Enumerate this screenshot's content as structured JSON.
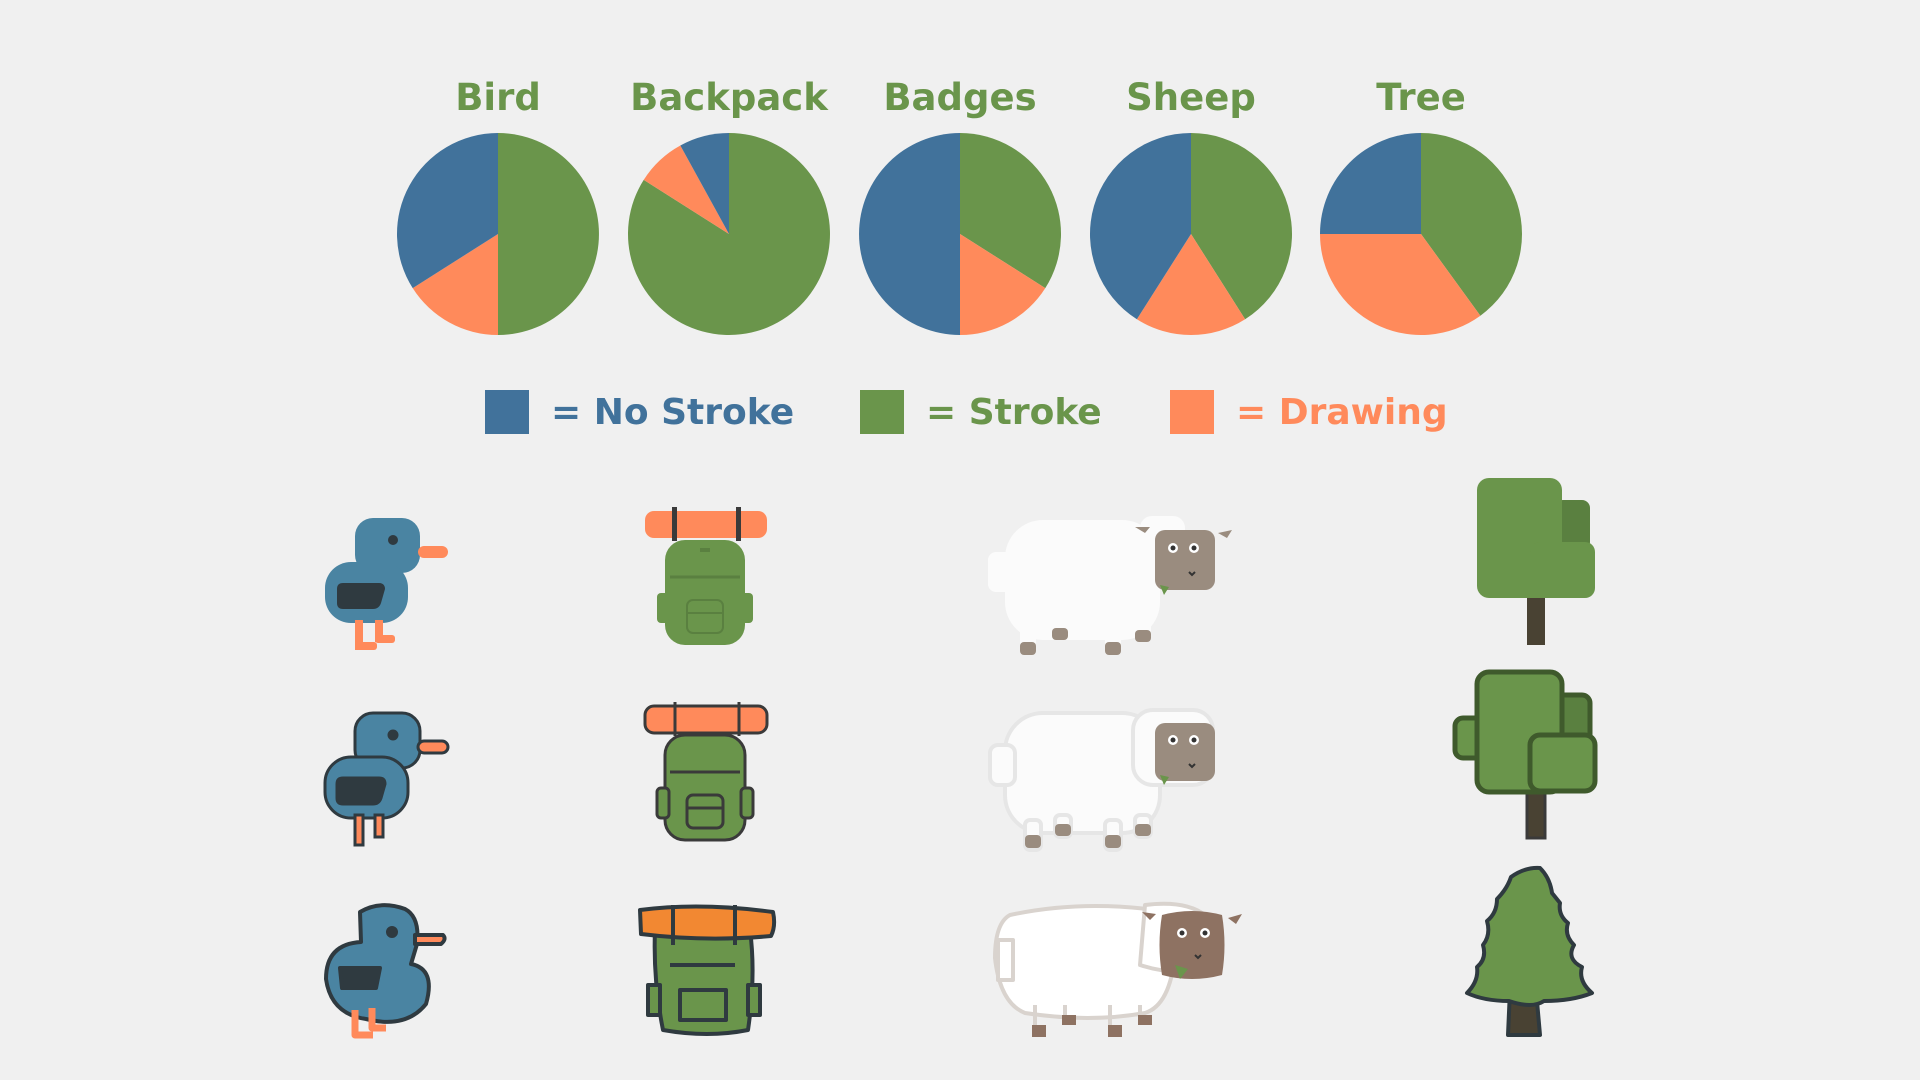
{
  "colors": {
    "no_stroke": "#41729b",
    "stroke": "#6a954b",
    "drawing": "#ff8a5b",
    "background": "#f0f0f0"
  },
  "chart_data": {
    "type": "pie",
    "charts": [
      {
        "title": "Bird",
        "slices": [
          {
            "label": "Stroke",
            "value": 50
          },
          {
            "label": "Drawing",
            "value": 16
          },
          {
            "label": "No Stroke",
            "value": 34
          }
        ]
      },
      {
        "title": "Backpack",
        "slices": [
          {
            "label": "Stroke",
            "value": 84
          },
          {
            "label": "Drawing",
            "value": 8
          },
          {
            "label": "No Stroke",
            "value": 8
          }
        ]
      },
      {
        "title": "Badges",
        "slices": [
          {
            "label": "Stroke",
            "value": 34
          },
          {
            "label": "Drawing",
            "value": 16
          },
          {
            "label": "No Stroke",
            "value": 50
          }
        ]
      },
      {
        "title": "Sheep",
        "slices": [
          {
            "label": "Stroke",
            "value": 41
          },
          {
            "label": "Drawing",
            "value": 18
          },
          {
            "label": "No Stroke",
            "value": 41
          }
        ]
      },
      {
        "title": "Tree",
        "slices": [
          {
            "label": "Stroke",
            "value": 40
          },
          {
            "label": "Drawing",
            "value": 35
          },
          {
            "label": "No Stroke",
            "value": 25
          }
        ]
      }
    ],
    "legend": [
      {
        "key": "no_stroke",
        "label": "= No Stroke"
      },
      {
        "key": "stroke",
        "label": "= Stroke"
      },
      {
        "key": "drawing",
        "label": "= Drawing"
      }
    ],
    "legend_placement": "below charts"
  },
  "illustrations": {
    "columns": [
      "bird",
      "backpack",
      "sheep",
      "tree"
    ],
    "rows": [
      "no-stroke",
      "stroke",
      "drawing"
    ]
  }
}
